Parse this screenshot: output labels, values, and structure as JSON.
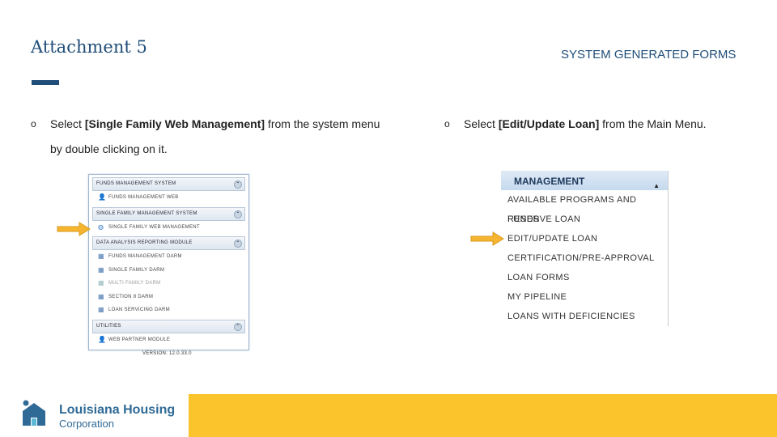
{
  "header": {
    "title": "Attachment 5",
    "subtitle": "SYSTEM GENERATED FORMS"
  },
  "bullets": {
    "left": {
      "marker": "o",
      "prefix": "Select ",
      "bold": "[Single Family Web Management]",
      "suffix": " from the system menu by double clicking on it."
    },
    "right": {
      "marker": "o",
      "prefix": "Select ",
      "bold": "[Edit/Update Loan]",
      "suffix": " from the Main Menu."
    }
  },
  "left_menu": {
    "sections": [
      {
        "header": "FUNDS MANAGEMENT SYSTEM",
        "items": [
          {
            "label": "FUNDS MANAGEMENT WEB",
            "icon": "person-icon",
            "dim": false
          }
        ]
      },
      {
        "header": "SINGLE FAMILY MANAGEMENT SYSTEM",
        "items": [
          {
            "label": "SINGLE FAMILY WEB MANAGEMENT",
            "icon": "globe-icon",
            "dim": false
          }
        ]
      },
      {
        "header": "DATA ANALYSIS REPORTING MODULE",
        "items": [
          {
            "label": "FUNDS MANAGEMENT DARM",
            "icon": "chart-icon",
            "dim": false
          },
          {
            "label": "SINGLE FAMILY DARM",
            "icon": "chart-icon",
            "dim": false
          },
          {
            "label": "MULTI FAMILY DARM",
            "icon": "chart-icon",
            "dim": true
          },
          {
            "label": "SECTION 8 DARM",
            "icon": "chart-icon",
            "dim": false
          },
          {
            "label": "LOAN SERVICING DARM",
            "icon": "chart-icon",
            "dim": false
          }
        ]
      },
      {
        "header": "UTILITIES",
        "items": [
          {
            "label": "WEB PARTNER MODULE",
            "icon": "person-icon",
            "dim": false
          }
        ]
      }
    ],
    "version": "VERSION: 12.0.33.0"
  },
  "right_menu": {
    "header": "MANAGEMENT",
    "items": [
      "AVAILABLE PROGRAMS AND FUNDS",
      "RESERVE LOAN",
      "EDIT/UPDATE LOAN",
      "CERTIFICATION/PRE-APPROVAL",
      "LOAN FORMS",
      "MY PIPELINE",
      "LOANS WITH DEFICIENCIES"
    ]
  },
  "footer": {
    "logo_line1": "Louisiana Housing",
    "logo_line2": "Corporation",
    "accent": "#fbc42d",
    "brand": "#2f6a96"
  }
}
